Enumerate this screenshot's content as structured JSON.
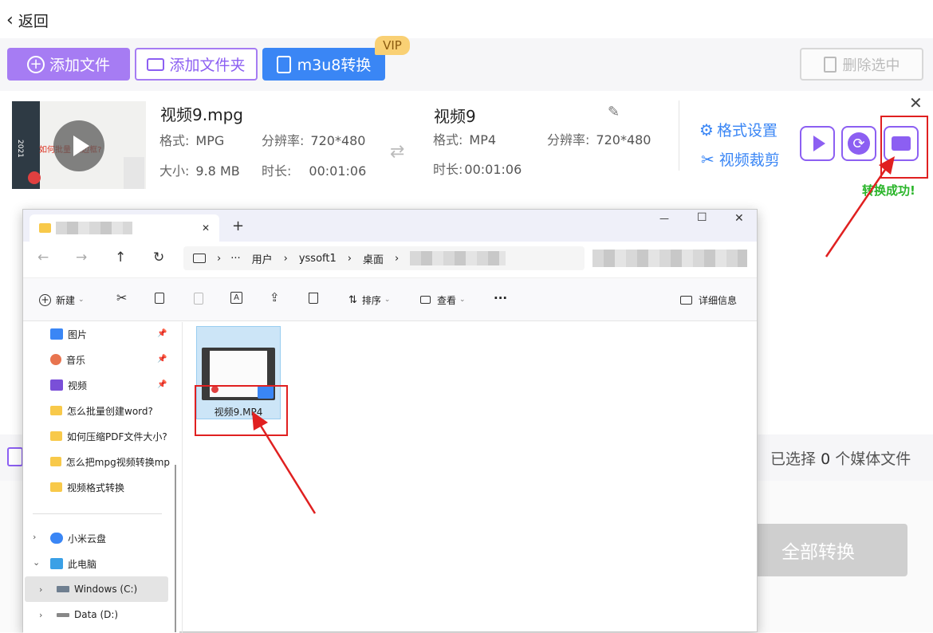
{
  "topbar": {
    "back_label": "返回"
  },
  "toolbar": {
    "add_file": "添加文件",
    "add_folder": "添加文件夹",
    "m3u8": "m3u8转换",
    "vip": "VIP",
    "delete": "删除选中"
  },
  "file_row": {
    "thumb_text": "如何批量 加边框?",
    "thumb_year": "2021",
    "src": {
      "name": "视频9.mpg",
      "format_label": "格式:",
      "format": "MPG",
      "res_label": "分辨率:",
      "res": "720*480",
      "size_label": "大小:",
      "size": "9.8 MB",
      "duration_label": "时长:",
      "duration": "00:01:06"
    },
    "dst": {
      "name": "视频9",
      "format_label": "格式:",
      "format": "MP4",
      "res_label": "分辨率:",
      "res": "720*480",
      "duration_label": "时长:",
      "duration": "00:01:06"
    },
    "format_settings": "格式设置",
    "video_crop": "视频裁剪",
    "status": "转换成功!"
  },
  "bottom": {
    "selected_prefix": "已选择",
    "selected_count": "0",
    "selected_suffix": "个媒体文件",
    "convert_all": "全部转换"
  },
  "explorer": {
    "tab_close": "✕",
    "new_tab": "+",
    "window_controls": [
      "—",
      "☐",
      "✕"
    ],
    "breadcrumb": [
      "用户",
      "yssoft1",
      "桌面"
    ],
    "breadcrumb_more": "···",
    "toolbar": {
      "new": "新建",
      "sort": "排序",
      "view": "查看",
      "more": "···",
      "details": "详细信息"
    },
    "quick_access": [
      {
        "label": "图片",
        "icon": "pictures-icon"
      },
      {
        "label": "音乐",
        "icon": "music-icon"
      },
      {
        "label": "视频",
        "icon": "videos-icon"
      },
      {
        "label": "怎么批量创建word?",
        "icon": "folder-icon"
      },
      {
        "label": "如何压缩PDF文件大小?",
        "icon": "folder-icon"
      },
      {
        "label": "怎么把mpg视频转换mp",
        "icon": "folder-icon"
      },
      {
        "label": "视频格式转换",
        "icon": "folder-icon"
      }
    ],
    "tree": [
      {
        "label": "小米云盘",
        "icon": "cloud-icon"
      },
      {
        "label": "此电脑",
        "icon": "pc-icon"
      },
      {
        "label": "Windows (C:)",
        "icon": "drive-icon"
      },
      {
        "label": "Data (D:)",
        "icon": "drive-icon"
      }
    ],
    "file": {
      "name": "视频9.MP4"
    }
  },
  "colors": {
    "accent": "#8c5ff2",
    "blue": "#3a86f5",
    "red": "#e02020",
    "success": "#2ab52a"
  }
}
